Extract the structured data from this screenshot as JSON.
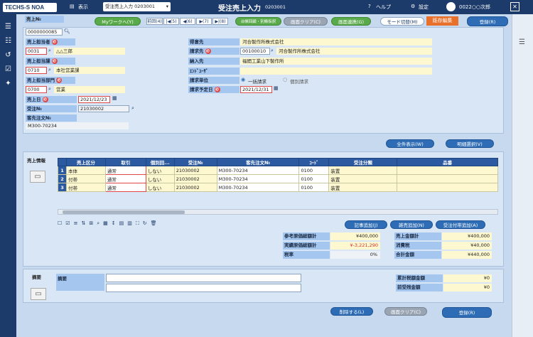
{
  "topbar": {
    "logo": "TECHS-S NOA",
    "display_menu": "表示",
    "screen_select": "受注売上入力 0203001",
    "title": "受注売上入力",
    "screen_code": "0203001",
    "help": "ヘルプ",
    "settings": "設定",
    "user": "0022○○次郎"
  },
  "toolbar": {
    "my_work": "Myワークへ(Y)",
    "nav": [
      "前回(4)",
      "|◀(5)",
      "◀(6)",
      "▶(7)",
      "▶|(8)"
    ],
    "history_copy": "台帳回顧・別帳採択",
    "clear": "画面クリア(C)",
    "screen_link": "画面連携(G)",
    "mode_switch": "モード切替(M)",
    "existing_edit": "既存編集",
    "register": "登録(R)"
  },
  "header": {
    "sales_no_label": "売上№",
    "sales_no": "0000000085",
    "sales_rep_label": "売上担当者",
    "sales_rep_code": "0031",
    "sales_rep_name": "△△三郎",
    "sales_dept_label": "売上担当課",
    "sales_dept_code": "0710",
    "sales_dept_name": "本社営業課",
    "sales_section_label": "売上担当部門",
    "sales_section_code": "0700",
    "sales_section_name": "営業",
    "sales_date_label": "売上日",
    "sales_date": "2021/12/23",
    "order_no_label": "受注№",
    "order_no": "21030002",
    "customer_order_label": "客先注文№",
    "customer_order": "M300-70234",
    "client_label": "得意先",
    "client_name": "河合製作所株式会社",
    "billing_label": "請求先",
    "billing_code": "00100010",
    "billing_name": "河合製作所株式会社",
    "delivery_label": "納入先",
    "delivery_name": "福間工業山下製作所",
    "enduser_label": "ｴﾝﾄﾞﾕｰｻﾞ",
    "billing_unit_label": "請求単位",
    "billing_unit_opt1": "一括請求",
    "billing_unit_opt2": "個別請求",
    "billing_date_label": "請求予定日",
    "billing_date": "2021/12/31"
  },
  "actions": {
    "show_all": "全件表示(W)",
    "detail_select": "明細選択(V)"
  },
  "lines": {
    "section_label": "売上情報",
    "columns": [
      "",
      "売上区分",
      "取引",
      "個別回...",
      "受注№",
      "客先注文№",
      "ｺｰﾄﾞ",
      "受注分類",
      "品番"
    ],
    "rows": [
      {
        "no": "1",
        "kubun": "本体",
        "torihiki": "通常",
        "kobetsu": "しない",
        "order": "21030002",
        "cust": "M300-70234",
        "code": "0100",
        "cls": "装置",
        "item": ""
      },
      {
        "no": "2",
        "kubun": "付帯",
        "torihiki": "通常",
        "kobetsu": "しない",
        "order": "21030002",
        "cust": "M300-70234",
        "code": "0100",
        "cls": "装置",
        "item": ""
      },
      {
        "no": "3",
        "kubun": "付帯",
        "torihiki": "通常",
        "kobetsu": "しない",
        "order": "21030002",
        "cust": "M300-70234",
        "code": "0100",
        "cls": "装置",
        "item": ""
      }
    ],
    "add_note": "記事追加(J)",
    "add_misc": "雑売追加(N)",
    "add_order": "受注付帯追加(A)"
  },
  "summary": {
    "ref_cost_label": "参考原価総額計",
    "ref_cost": "¥400,000",
    "actual_cost_label": "実績原価総額計",
    "actual_cost": "¥-3,221,290",
    "tax_rate_label": "税率",
    "tax_rate": "0%",
    "sales_total_label": "売上金額計",
    "sales_total": "¥400,000",
    "consumption_tax_label": "消費税",
    "consumption_tax": "¥40,000",
    "grand_total_label": "合計金額",
    "grand_total": "¥440,000"
  },
  "memo": {
    "section_label": "摘要",
    "memo_label": "摘要",
    "cumulative_tax_label": "累計税額金額",
    "cumulative_tax": "¥0",
    "prev_change_label": "前受残金額",
    "prev_change": "¥0"
  },
  "footer": {
    "delete": "削除する(L)",
    "clear": "画面クリア(C)",
    "register": "登録(R)"
  }
}
